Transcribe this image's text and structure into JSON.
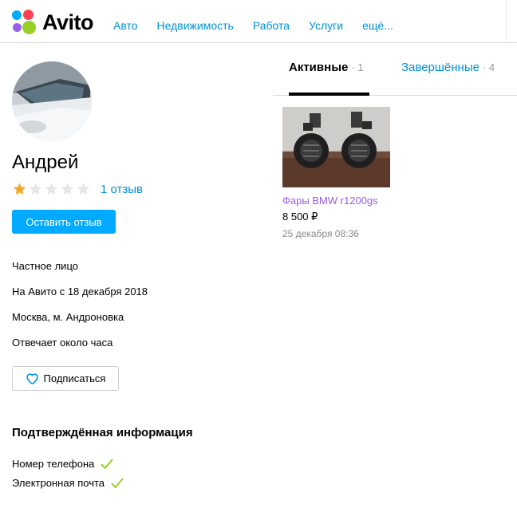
{
  "header": {
    "logo_text": "Avito",
    "nav": [
      "Авто",
      "Недвижимость",
      "Работа",
      "Услуги",
      "ещё..."
    ]
  },
  "profile": {
    "name": "Андрей",
    "rating": 1,
    "rating_max": 5,
    "reviews_link": "1 отзыв",
    "leave_review_button": "Оставить отзыв",
    "type": "Частное лицо",
    "member_since": "На Авито с 18 декабря 2018",
    "location": "Москва, м. Андроновка",
    "response_time": "Отвечает около часа",
    "subscribe_button": "Подписаться"
  },
  "verified": {
    "title": "Подтверждённая информация",
    "items": [
      "Номер телефона",
      "Электронная почта"
    ]
  },
  "tabs": {
    "active": {
      "label": "Активные",
      "count": "· 1"
    },
    "done": {
      "label": "Завершённые",
      "count": "· 4"
    }
  },
  "listing": {
    "title": "Фары BMW r1200gs",
    "price": "8 500 ₽",
    "date": "25 декабря 08:36"
  },
  "colors": {
    "brand_blue": "#00aaff",
    "link_blue": "#0091d9",
    "listing_purple": "#965eeb",
    "star_gold": "#f5a623",
    "check_green": "#97cf26"
  }
}
